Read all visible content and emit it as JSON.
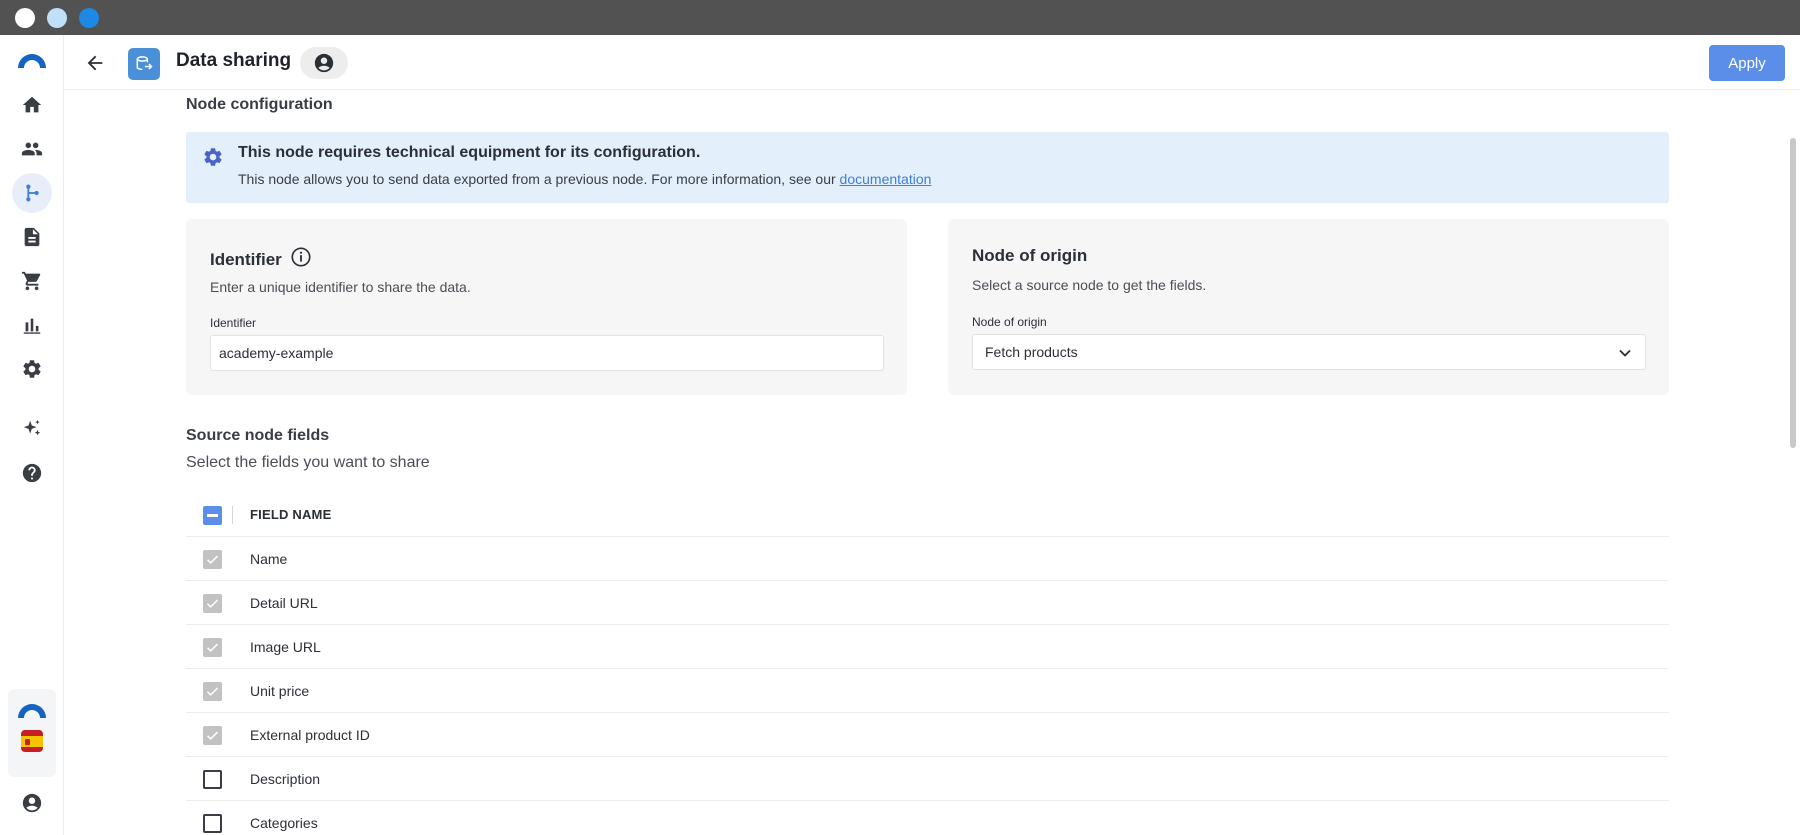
{
  "header": {
    "title": "Data sharing",
    "apply_label": "Apply"
  },
  "rail": {
    "items": [
      {
        "name": "home-icon",
        "active": false
      },
      {
        "name": "people-icon",
        "active": false
      },
      {
        "name": "flow-icon",
        "active": true
      },
      {
        "name": "document-icon",
        "active": false
      },
      {
        "name": "cart-icon",
        "active": false
      },
      {
        "name": "bar-chart-icon",
        "active": false
      },
      {
        "name": "gear-icon",
        "active": false
      },
      {
        "name": "sparkle-icon",
        "active": false
      },
      {
        "name": "help-icon",
        "active": false
      }
    ]
  },
  "main": {
    "section_title": "Node configuration",
    "banner": {
      "title": "This node requires technical equipment for its configuration.",
      "text": "This node allows you to send data exported from a previous node. For more information, see our",
      "link": "documentation"
    },
    "identifier_card": {
      "title": "Identifier",
      "description": "Enter a unique identifier to share the data.",
      "field_label": "Identifier",
      "value": "academy-example"
    },
    "origin_card": {
      "title": "Node of origin",
      "description": "Select a source node to get the fields.",
      "field_label": "Node of origin",
      "selected": "Fetch products"
    },
    "fields_section": {
      "title": "Source node fields",
      "subtitle": "Select the fields you want to share",
      "column_header": "FIELD NAME",
      "rows": [
        {
          "label": "Name",
          "checked": true
        },
        {
          "label": "Detail URL",
          "checked": true
        },
        {
          "label": "Image URL",
          "checked": true
        },
        {
          "label": "Unit price",
          "checked": true
        },
        {
          "label": "External product ID",
          "checked": true
        },
        {
          "label": "Description",
          "checked": false
        },
        {
          "label": "Categories",
          "checked": false
        }
      ]
    }
  },
  "colors": {
    "accent": "#5b8ee8",
    "banner_bg": "#e3effb",
    "titlebar": "#525252"
  }
}
